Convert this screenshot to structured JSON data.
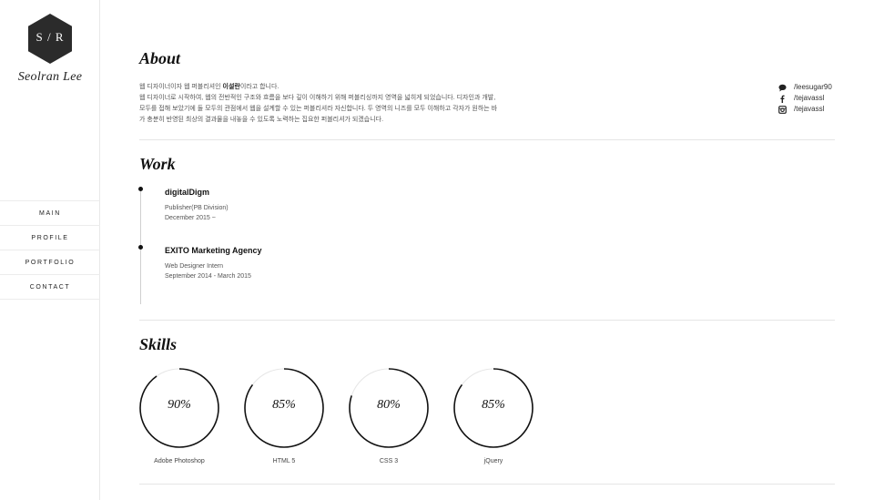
{
  "sidebar": {
    "logo_text": "S / R",
    "site_name": "Seolran Lee",
    "nav": [
      {
        "label": "MAIN"
      },
      {
        "label": "PROFILE"
      },
      {
        "label": "PORTFOLIO"
      },
      {
        "label": "CONTACT"
      }
    ]
  },
  "about": {
    "title": "About",
    "line1_pre": "웹 디자이너이자 웹 퍼블리셔인 ",
    "line1_name": "이설란",
    "line1_post": "이라고 합니다.",
    "line2": "웹 디자이너로 시작하여, 웹의 전반적인 구조와 흐름을 보다 깊이 이해하기 위해 퍼블리싱까지 영역을 넓히게 되었습니다. 디자인과 개발,",
    "line3": "모두를 접해 보았기에 둘 모두의 관점에서 웹을 설계할 수 있는 퍼블리셔라 자신합니다. 두 영역의 니즈를 모두 이해하고 각자가 원하는 바",
    "line4": "가 충분히 반영된 최상의 결과물을 내놓을 수 있도록 노력하는 집요한 퍼블리셔가 되겠습니다.",
    "social": [
      {
        "icon": "speech-bubble-icon",
        "label": "/leesugar90"
      },
      {
        "icon": "facebook-icon",
        "label": "/tejavassl"
      },
      {
        "icon": "instagram-icon",
        "label": "/tejavassl"
      }
    ]
  },
  "work": {
    "title": "Work",
    "jobs": [
      {
        "company": "digitalDigm",
        "role": "Publisher(PB Division)",
        "date": "December 2015 ~"
      },
      {
        "company": "EXITO Marketing Agency",
        "role": "Web Designer Intern",
        "date": "September 2014 - March 2015"
      }
    ]
  },
  "skills": {
    "title": "Skills",
    "items": [
      {
        "name": "Adobe Photoshop",
        "percent_label": "90%",
        "percent": 90
      },
      {
        "name": "HTML 5",
        "percent_label": "85%",
        "percent": 85
      },
      {
        "name": "CSS 3",
        "percent_label": "80%",
        "percent": 80
      },
      {
        "name": "jQuery",
        "percent_label": "85%",
        "percent": 85
      }
    ]
  },
  "colors": {
    "ring": "#111111",
    "ring_track": "#e6e6e6",
    "logo_fill": "#2b2b2b"
  }
}
